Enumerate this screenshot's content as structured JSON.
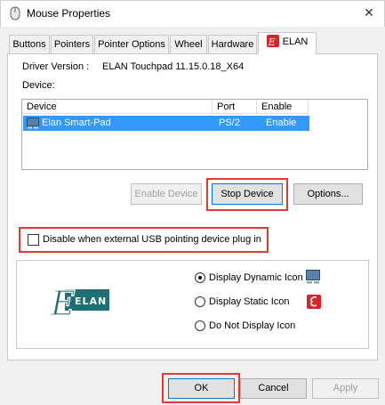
{
  "window": {
    "title": "Mouse Properties",
    "close_glyph": "✕"
  },
  "tabs": [
    {
      "label": "Buttons"
    },
    {
      "label": "Pointers"
    },
    {
      "label": "Pointer Options"
    },
    {
      "label": "Wheel"
    },
    {
      "label": "Hardware"
    },
    {
      "label": "ELAN",
      "icon": "elan-icon"
    }
  ],
  "elan": {
    "driver_version_label": "Driver Version :",
    "driver_version_value": "ELAN Touchpad 11.15.0.18_X64",
    "device_label": "Device:",
    "table": {
      "columns": [
        "Device",
        "Port",
        "Enable"
      ],
      "rows": [
        {
          "device": "Elan Smart-Pad",
          "port": "PS/2",
          "enable": "Enable",
          "selected": true
        }
      ]
    },
    "buttons": {
      "enable_device": "Enable Device",
      "stop_device": "Stop Device",
      "options": "Options..."
    },
    "disable_usb_checkbox": {
      "label": "Disable when external USB pointing device plug in",
      "checked": false
    },
    "logo_text": "ELAN",
    "display_options": [
      {
        "label": "Display Dynamic Icon",
        "checked": true
      },
      {
        "label": "Display Static Icon",
        "checked": false
      },
      {
        "label": "Do Not Display Icon",
        "checked": false
      }
    ]
  },
  "footer": {
    "ok": "OK",
    "cancel": "Cancel",
    "apply": "Apply"
  },
  "colors": {
    "selection": "#3399ff",
    "highlight_box": "#e53935",
    "elan_red": "#d9232a",
    "elan_teal": "#1d6f73"
  }
}
